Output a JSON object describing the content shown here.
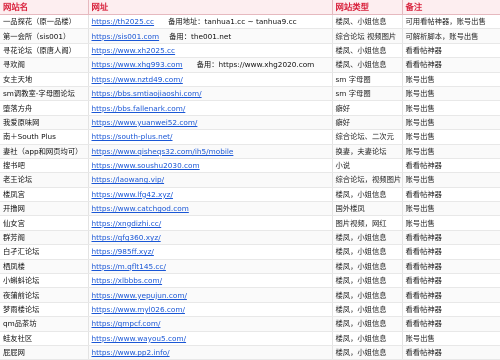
{
  "headers": [
    "网站名",
    "网址",
    "网站类型",
    "备注"
  ],
  "rows": [
    {
      "name": "一品探花（原一品楼）",
      "url": "https://th2025.cc",
      "extra": "备用地址：tanhua1.cc ~ tanhua9.cc",
      "type": "楼凤、小姐信息",
      "note": "可用看帖神器，账号出售"
    },
    {
      "name": "第一会所（sis001）",
      "url": "https://sis001.com",
      "extra": "备用：the001.net",
      "type": "综合论坛 视频图片",
      "note": "可解析脚本，账号出售"
    },
    {
      "name": "寻花论坛（原唐人阁）",
      "url": "https://www.xh2025.cc",
      "extra": "",
      "type": "楼凤、小姐信息",
      "note": "看看帖神器"
    },
    {
      "name": "寻欢阁",
      "url": "https://www.xhg993.com",
      "extra": "备用：https://www.xhg2020.com",
      "type": "楼凤、小姐信息",
      "note": "看看帖神器"
    },
    {
      "name": "女主天地",
      "url": "https://www.nztd49.com/",
      "extra": "",
      "type": "sm 字母圈",
      "note": "账号出售"
    },
    {
      "name": "sm调教室-字母圈论坛",
      "url": "https://bbs.smtiaojiaoshi.com/",
      "extra": "",
      "type": "sm 字母圈",
      "note": "账号出售"
    },
    {
      "name": "堕落方舟",
      "url": "https://bbs.fallenark.com/",
      "extra": "",
      "type": "癖好",
      "note": "账号出售"
    },
    {
      "name": "我爱原味网",
      "url": "https://www.yuanwei52.com/",
      "extra": "",
      "type": "癖好",
      "note": "账号出售"
    },
    {
      "name": "南＋South Plus",
      "url": "https://south-plus.net/",
      "extra": "",
      "type": "综合论坛、二次元",
      "note": "账号出售"
    },
    {
      "name": "妻社（app和网页均可）",
      "url": "https://www.qisheqs32.com/ih5/mobile",
      "extra": "",
      "type": "换妻，夫妻论坛",
      "note": "账号出售"
    },
    {
      "name": "搜书吧",
      "url": "https://www.soushu2030.com",
      "extra": "",
      "type": "小说",
      "note": "看看帖神器"
    },
    {
      "name": "老王论坛",
      "url": "https://laowang.vip/",
      "extra": "",
      "type": "综合论坛，视频图片",
      "note": "账号出售"
    },
    {
      "name": "楼凤宫",
      "url": "https://www.lfg42.xyz/",
      "extra": "",
      "type": "楼凤，小姐信息",
      "note": "看看帖神器"
    },
    {
      "name": "开撸网",
      "url": "https://www.catchgod.com",
      "extra": "",
      "type": "国外楼凤",
      "note": "账号出售"
    },
    {
      "name": "仙女宫",
      "url": "https://xngdizhi.cc/",
      "extra": "",
      "type": "图片视频，网红",
      "note": "账号出售"
    },
    {
      "name": "群芳阁",
      "url": "https://qfg360.xyz/",
      "extra": "",
      "type": "楼凤，小姐信息",
      "note": "看看帖神器"
    },
    {
      "name": "白孑汇论坛",
      "url": "https://985ff.xyz/",
      "extra": "",
      "type": "楼凤，小姐信息",
      "note": "看看帖神器"
    },
    {
      "name": "栖凤楼",
      "url": "https://m.qflt145.cc/",
      "extra": "",
      "type": "楼凤，小姐信息",
      "note": "看看帖神器"
    },
    {
      "name": "小蝌蚪论坛",
      "url": "https://xlbbbs.com/",
      "extra": "",
      "type": "楼凤，小姐信息",
      "note": "看看帖神器"
    },
    {
      "name": "夜蒲前论坛",
      "url": "https://www.yepujun.com/",
      "extra": "",
      "type": "楼凤，小姐信息",
      "note": "看看帖神器"
    },
    {
      "name": "梦雨楼论坛",
      "url": "https://www.myl026.com/",
      "extra": "",
      "type": "楼凤，小姐信息",
      "note": "看看帖神器"
    },
    {
      "name": "qm品茶坊",
      "url": "https://qmpcf.com/",
      "extra": "",
      "type": "楼凤，小姐信息",
      "note": "看看帖神器"
    },
    {
      "name": "蛙友社区",
      "url": "https://www.wayou5.com/",
      "extra": "",
      "type": "楼凤，小姐信息",
      "note": "账号出售"
    },
    {
      "name": "屁屁网",
      "url": "https://www.pp2.info/",
      "extra": "",
      "type": "楼凤，小姐信息",
      "note": "看看帖神器"
    }
  ],
  "colors": {
    "header_bg": "#fdeef0",
    "header_text": "#d81f3a",
    "link": "#1a57d6"
  }
}
